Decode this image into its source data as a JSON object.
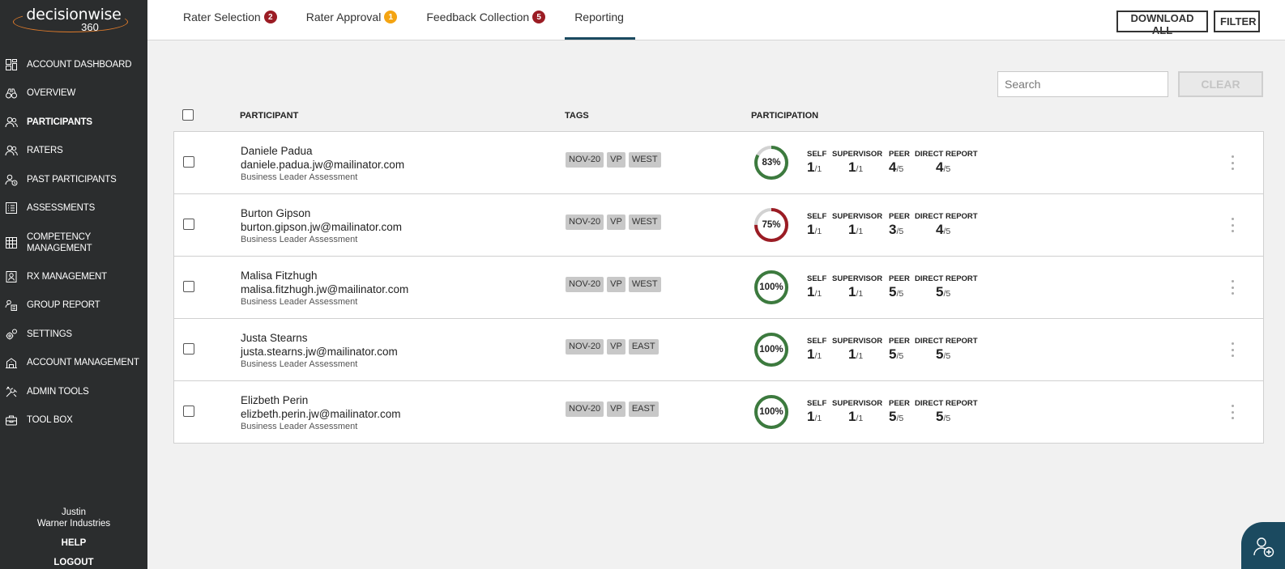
{
  "brand": {
    "name": "decisionwise",
    "sub": "360"
  },
  "sidebar": {
    "items": [
      {
        "label": "ACCOUNT DASHBOARD",
        "icon": "dashboard-icon"
      },
      {
        "label": "OVERVIEW",
        "icon": "binoculars-icon"
      },
      {
        "label": "PARTICIPANTS",
        "icon": "users-icon"
      },
      {
        "label": "RATERS",
        "icon": "users-icon"
      },
      {
        "label": "PAST PARTICIPANTS",
        "icon": "users-history-icon"
      },
      {
        "label": "ASSESSMENTS",
        "icon": "checklist-icon"
      },
      {
        "label": "COMPETENCY MANAGEMENT",
        "icon": "grid-icon"
      },
      {
        "label": "RX MANAGEMENT",
        "icon": "user-card-icon"
      },
      {
        "label": "GROUP REPORT",
        "icon": "group-report-icon"
      },
      {
        "label": "SETTINGS",
        "icon": "gears-icon"
      },
      {
        "label": "ACCOUNT MANAGEMENT",
        "icon": "building-icon"
      },
      {
        "label": "ADMIN TOOLS",
        "icon": "tools-icon"
      },
      {
        "label": "TOOL BOX",
        "icon": "toolbox-icon"
      }
    ],
    "user_name": "Justin",
    "company": "Warner Industries",
    "help": "HELP",
    "logout": "LOGOUT"
  },
  "header": {
    "tabs": [
      {
        "label": "Rater Selection",
        "badge": "2",
        "badge_color": "#9b1c24"
      },
      {
        "label": "Rater Approval",
        "badge": "1",
        "badge_color": "#f4a412"
      },
      {
        "label": "Feedback Collection",
        "badge": "5",
        "badge_color": "#9b1c24"
      },
      {
        "label": "Reporting",
        "badge": "",
        "badge_color": ""
      }
    ],
    "download_all": "DOWNLOAD ALL",
    "filter": "FILTER"
  },
  "search": {
    "placeholder": "Search",
    "value": "",
    "clear": "CLEAR"
  },
  "columns": {
    "participant": "PARTICIPANT",
    "tags": "TAGS",
    "participation": "PARTICIPATION"
  },
  "stat_labels": {
    "self": "SELF",
    "supervisor": "SUPERVISOR",
    "peer": "PEER",
    "direct": "DIRECT REPORT"
  },
  "colors": {
    "complete": "#3c7a3e",
    "incomplete": "#9b1c24",
    "track": "#d2d2d2",
    "accent": "#1b4a60"
  },
  "participants": [
    {
      "name": "Daniele Padua",
      "email": "daniele.padua.jw@mailinator.com",
      "assessment": "Business Leader Assessment",
      "tags": [
        "NOV-20",
        "VP",
        "WEST"
      ],
      "percent_label": "83%",
      "percent": 83,
      "status": "complete",
      "self": "1",
      "self_total": "/1",
      "supervisor": "1",
      "supervisor_total": "/1",
      "peer": "4",
      "peer_total": "/5",
      "direct": "4",
      "direct_total": "/5"
    },
    {
      "name": "Burton Gipson",
      "email": "burton.gipson.jw@mailinator.com",
      "assessment": "Business Leader Assessment",
      "tags": [
        "NOV-20",
        "VP",
        "WEST"
      ],
      "percent_label": "75%",
      "percent": 75,
      "status": "incomplete",
      "self": "1",
      "self_total": "/1",
      "supervisor": "1",
      "supervisor_total": "/1",
      "peer": "3",
      "peer_total": "/5",
      "direct": "4",
      "direct_total": "/5"
    },
    {
      "name": "Malisa Fitzhugh",
      "email": "malisa.fitzhugh.jw@mailinator.com",
      "assessment": "Business Leader Assessment",
      "tags": [
        "NOV-20",
        "VP",
        "WEST"
      ],
      "percent_label": "100%",
      "percent": 100,
      "status": "complete",
      "self": "1",
      "self_total": "/1",
      "supervisor": "1",
      "supervisor_total": "/1",
      "peer": "5",
      "peer_total": "/5",
      "direct": "5",
      "direct_total": "/5"
    },
    {
      "name": "Justa Stearns",
      "email": "justa.stearns.jw@mailinator.com",
      "assessment": "Business Leader Assessment",
      "tags": [
        "NOV-20",
        "VP",
        "EAST"
      ],
      "percent_label": "100%",
      "percent": 100,
      "status": "complete",
      "self": "1",
      "self_total": "/1",
      "supervisor": "1",
      "supervisor_total": "/1",
      "peer": "5",
      "peer_total": "/5",
      "direct": "5",
      "direct_total": "/5"
    },
    {
      "name": "Elizbeth Perin",
      "email": "elizbeth.perin.jw@mailinator.com",
      "assessment": "Business Leader Assessment",
      "tags": [
        "NOV-20",
        "VP",
        "EAST"
      ],
      "percent_label": "100%",
      "percent": 100,
      "status": "complete",
      "self": "1",
      "self_total": "/1",
      "supervisor": "1",
      "supervisor_total": "/1",
      "peer": "5",
      "peer_total": "/5",
      "direct": "5",
      "direct_total": "/5"
    }
  ]
}
